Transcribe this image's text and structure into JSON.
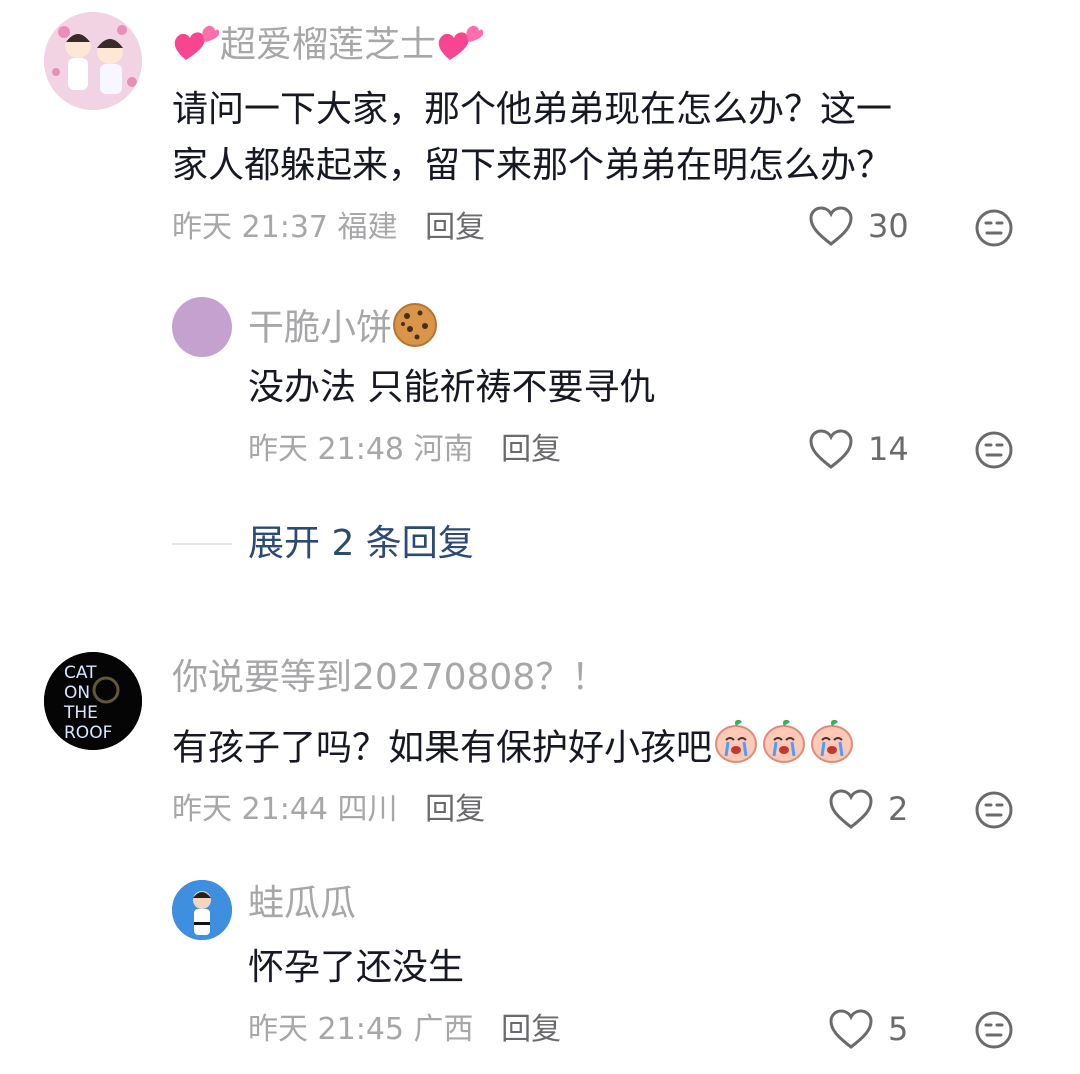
{
  "comments": [
    {
      "username": "超爱榴莲芝士",
      "text_line1": "请问一下大家，那个他弟弟现在怎么办？这一",
      "text_line2": "家人都躲起来，留下来那个弟弟在明怎么办？",
      "time": "昨天 21:37",
      "location": "福建",
      "reply_label": "回复",
      "likes": "30"
    },
    {
      "username": "干脆小饼",
      "text": "没办法 只能祈祷不要寻仇",
      "time": "昨天 21:48",
      "location": "河南",
      "reply_label": "回复",
      "likes": "14"
    },
    {
      "username": "你说要等到20270808？！",
      "text": "有孩子了吗？如果有保护好小孩吧",
      "time": "昨天 21:44",
      "location": "四川",
      "reply_label": "回复",
      "likes": "2"
    },
    {
      "username": "蛙瓜瓜",
      "text": "怀孕了还没生",
      "time": "昨天 21:45",
      "location": "广西",
      "reply_label": "回复",
      "likes": "5"
    }
  ],
  "expand_replies": "展开 2 条回复",
  "avatar3_logo": "CAT ON THE ROOF",
  "colors": {
    "name": "#a7a7a9",
    "text": "#161823",
    "link": "#2c4a73",
    "avatar2": "#c4a1cf"
  },
  "icons": [
    "heart-icon",
    "emoji-icon",
    "two-hearts-icon",
    "cookie-icon",
    "crying-peach-icon"
  ]
}
